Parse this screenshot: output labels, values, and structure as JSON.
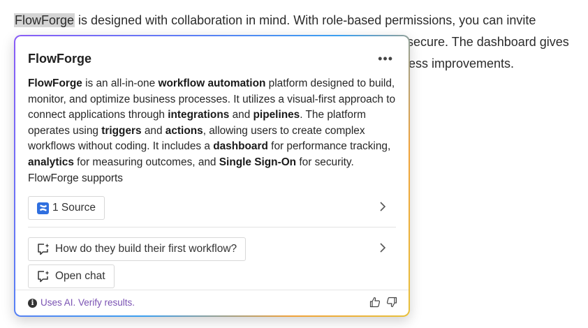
{
  "background": {
    "highlighted_word": "FlowForge",
    "line1_rest": " is designed with collaboration in mind. With role-based permissions, you can invite",
    "line2_tail": "secure. The dashboard gives",
    "line3_tail": "ess improvements."
  },
  "card": {
    "title": "FlowForge",
    "more_label": "•••",
    "summary": [
      {
        "t": "FlowForge",
        "b": true
      },
      {
        "t": " is an all-in-one ",
        "b": false
      },
      {
        "t": "workflow automation",
        "b": true
      },
      {
        "t": " platform designed to build, monitor, and optimize business processes. It utilizes a visual-first approach to connect applications through ",
        "b": false
      },
      {
        "t": "integrations",
        "b": true
      },
      {
        "t": " and ",
        "b": false
      },
      {
        "t": "pipelines",
        "b": true
      },
      {
        "t": ". The platform operates using ",
        "b": false
      },
      {
        "t": "triggers",
        "b": true
      },
      {
        "t": " and ",
        "b": false
      },
      {
        "t": "actions",
        "b": true
      },
      {
        "t": ", allowing users to create complex workflows without coding. It includes a ",
        "b": false
      },
      {
        "t": "dashboard",
        "b": true
      },
      {
        "t": " for performance tracking, ",
        "b": false
      },
      {
        "t": "analytics",
        "b": true
      },
      {
        "t": " for measuring outcomes, and ",
        "b": false
      },
      {
        "t": "Single Sign-On",
        "b": true
      },
      {
        "t": " for security. FlowForge supports",
        "b": false
      }
    ],
    "source_label": "1 Source",
    "source_icon": "confluence-logo-icon",
    "followup_question": "How do they build their first workflow?",
    "open_chat_label": "Open chat",
    "footer_note": "Uses AI. Verify results.",
    "info_glyph": "i",
    "colors": {
      "accent_purple": "#7a52b3",
      "source_logo_blue": "#2f6fdf",
      "border_gradient": [
        "#8a5cf6",
        "#3ba0f0",
        "#f0a23a",
        "#e8c13b"
      ]
    }
  }
}
